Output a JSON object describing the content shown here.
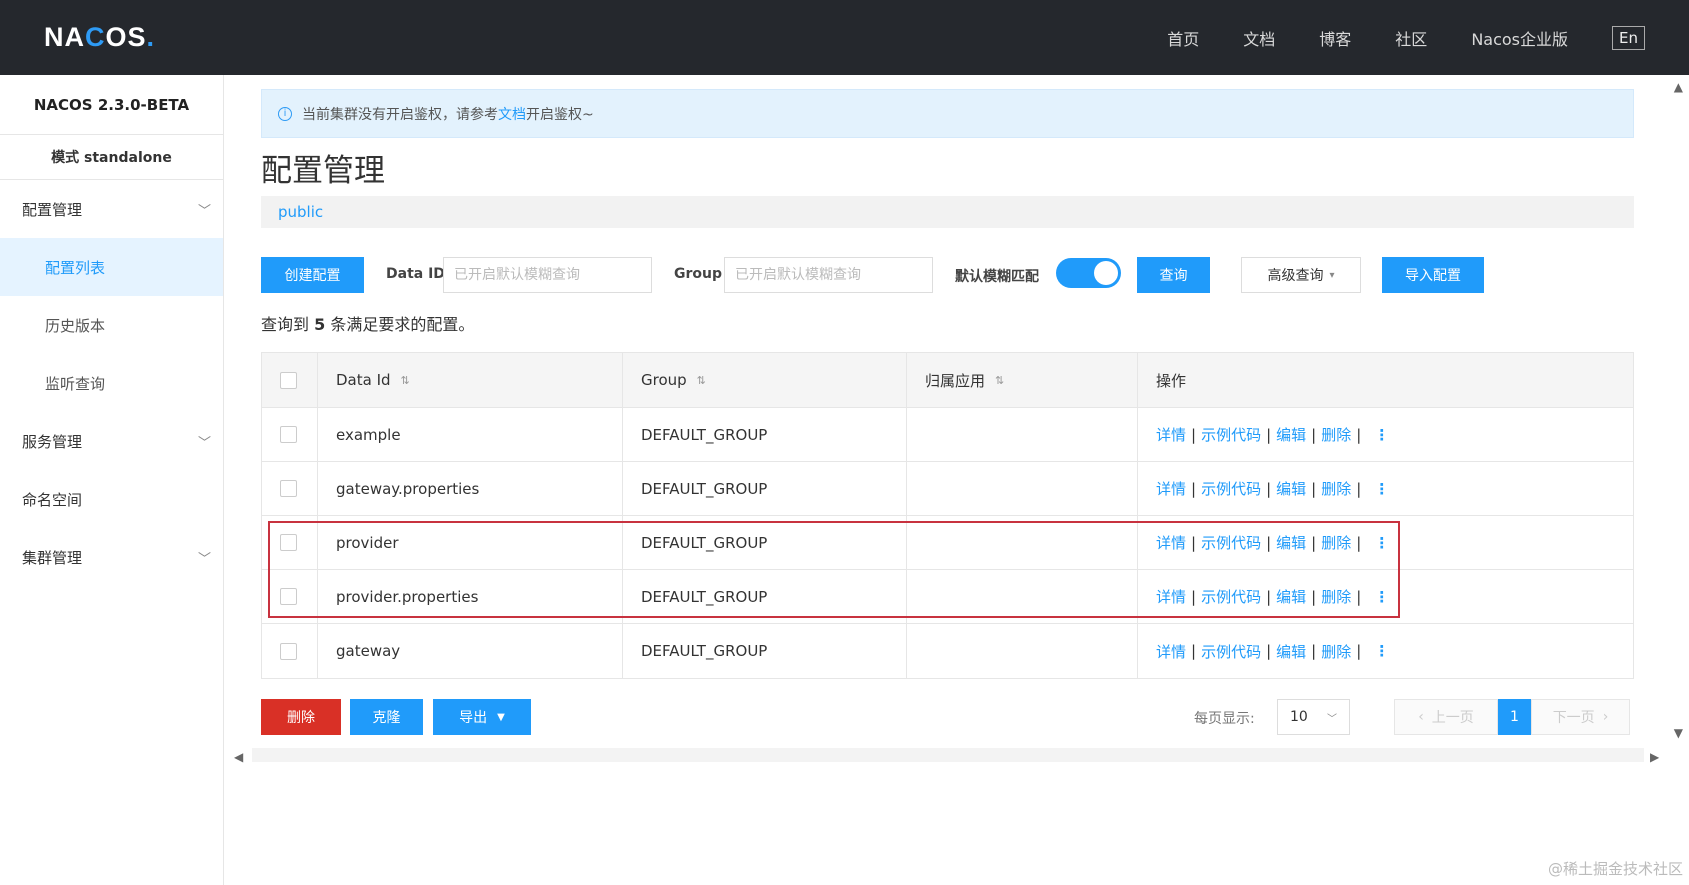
{
  "topbar": {
    "logo": "NACOS",
    "nav": [
      "首页",
      "文档",
      "博客",
      "社区",
      "Nacos企业版"
    ],
    "lang": "En"
  },
  "sidebar": {
    "version": "NACOS 2.3.0-BETA",
    "mode": "模式 standalone",
    "groups": [
      {
        "label": "配置管理",
        "items": [
          "配置列表",
          "历史版本",
          "监听查询"
        ]
      },
      {
        "label": "服务管理"
      },
      {
        "label": "命名空间"
      },
      {
        "label": "集群管理"
      }
    ]
  },
  "notice": {
    "prefix": "当前集群没有开启鉴权，请参考",
    "link": "文档",
    "suffix": "开启鉴权~"
  },
  "page": {
    "title": "配置管理",
    "namespace": "public"
  },
  "toolbar": {
    "create_label": "创建配置",
    "dataid_label": "Data ID",
    "dataid_placeholder": "已开启默认模糊查询",
    "group_label": "Group",
    "group_placeholder": "已开启默认模糊查询",
    "fuzzy_label": "默认模糊匹配",
    "query_label": "查询",
    "advanced_label": "高级查询",
    "import_label": "导入配置"
  },
  "result": {
    "prefix": "查询到",
    "count": "5",
    "suffix": "条满足要求的配置。"
  },
  "table": {
    "headers": [
      "Data Id",
      "Group",
      "归属应用",
      "操作"
    ],
    "rows": [
      {
        "dataid": "example",
        "group": "DEFAULT_GROUP",
        "app": ""
      },
      {
        "dataid": "gateway.properties",
        "group": "DEFAULT_GROUP",
        "app": ""
      },
      {
        "dataid": "provider",
        "group": "DEFAULT_GROUP",
        "app": ""
      },
      {
        "dataid": "provider.properties",
        "group": "DEFAULT_GROUP",
        "app": ""
      },
      {
        "dataid": "gateway",
        "group": "DEFAULT_GROUP",
        "app": ""
      }
    ],
    "ops": {
      "detail": "详情",
      "sample": "示例代码",
      "edit": "编辑",
      "delete": "删除"
    }
  },
  "footer": {
    "delete_label": "删除",
    "clone_label": "克隆",
    "export_label": "导出",
    "page_size_label": "每页显示:",
    "page_size": "10",
    "prev": "上一页",
    "current_page": "1",
    "next": "下一页"
  },
  "watermark": "@稀土掘金技术社区",
  "colors": {
    "primary": "#209bfa",
    "danger": "#d93026",
    "topbar": "#25282d",
    "highlight": "#c8323f"
  }
}
